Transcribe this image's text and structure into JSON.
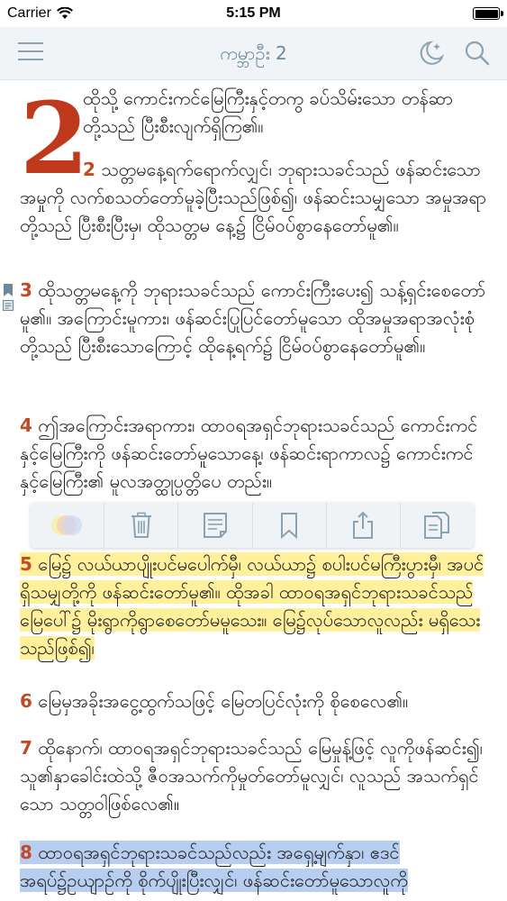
{
  "status_bar": {
    "carrier": "Carrier",
    "time": "5:15 PM"
  },
  "nav": {
    "title": "ကမ္ဘာဦး 2"
  },
  "chapter": {
    "dropcap": "2",
    "verse1": "ထိုသို့ ကောင်းကင်မြေကြီးနှင့်တကွ ခပ်သိမ်းသော တန်ဆာတို့သည် ပြီးစီးလျက်ရှိကြ၏။",
    "verses": [
      {
        "num": "2",
        "text": "သတ္တမနေ့ရက်ရောက်လျှင်၊ ဘုရားသခင်သည် ဖန်ဆင်းသောအမှုကို လက်စသတ်တော်မူခဲ့ပြီးသည်ဖြစ်၍၊ ဖန်ဆင်းသမျှသော အမှုအရာတို့သည် ပြီးစီးပြီးမှ၊ ထိုသတ္တမ နေ့၌ ငြိမ်ဝပ်စွာနေတော်မူ၏။"
      },
      {
        "num": "3",
        "text": "ထိုသတ္တမနေ့ကို ဘုရားသခင်သည် ကောင်းကြီးပေး၍ သန့်ရှင်းစေတော်မူ၏။ အကြောင်းမူကား၊ ဖန်ဆင်းပြုပြင်တော်မူသော ထိုအမှုအရာအလုံးစုံတို့သည် ပြီးစီးသောကြောင့် ထိုနေ့ရက်၌ ငြိမ်ဝပ်စွာနေတော်မူ၏။"
      },
      {
        "num": "4",
        "text": "ဤအကြောင်းအရာကား၊ ထာဝရအရှင်ဘုရားသခင်သည် ကောင်းကင်နှင့်မြေကြီးကို ဖန်ဆင်းတော်မူသောနေ့၊ ဖန်ဆင်းရာကာလ၌ ကောင်းကင်နှင့်မြေကြီး၏ မူလအတ္ထုပ္ပတ္တိပေ တည်း။"
      },
      {
        "num": "5",
        "text": "မြေ၌ လယ်ယာပျိုးပင်မပေါက်မှီ၊ လယ်ယာ၌ စပါးပင်မကြီးပွားမှီ၊ အပင်ရှိသမျှတို့ကို ဖန်ဆင်းတော်မူ၏။ ထိုအခါ ထာဝရအရှင်ဘုရားသခင်သည် မြေပေါ်၌ မိုးရွာကိုရွာစေတော်မမူသေး။ မြေ၌လုပ်သောလူလည်း မရှိသေးသည်ဖြစ်၍၊"
      },
      {
        "num": "6",
        "text": "မြေမှအခိုးအငွေ့ထွက်သဖြင့် မြေတပြင်လုံးကို စိုစေလေ၏။"
      },
      {
        "num": "7",
        "text": "ထိုနောက်၊ ထာဝရအရှင်ဘုရားသခင်သည် မြေမှုန့်ဖြင့် လူကိုဖန်ဆင်း၍၊ သူ၏နှာခေါင်းထဲသို့ ဇီဝအသက်ကိုမှုတ်တော်မူလျှင်၊ လူသည် အသက်ရှင်သော သတ္တဝါဖြစ်လေ၏။"
      },
      {
        "num": "8",
        "text": "ထာဝရအရှင်ဘုရားသခင်သည်လည်း အရှေ့မျက်နှာ၊ ဧဒင်အရပ်၌ဥယျာဉ်ကို စိုက်ပျိုးပြီးလျှင်၊ ဖန်ဆင်းတော်မူသောလူကို"
      }
    ]
  },
  "colors": {
    "accent": "#c14a25",
    "nav_tint": "#8aa3b2",
    "highlight_yellow": "#ffe46a",
    "highlight_blue": "#7da5e6"
  },
  "toolbar": {
    "icons": [
      "color-palette-icon",
      "trash-icon",
      "note-icon",
      "bookmark-icon",
      "share-icon",
      "copy-icon"
    ]
  }
}
